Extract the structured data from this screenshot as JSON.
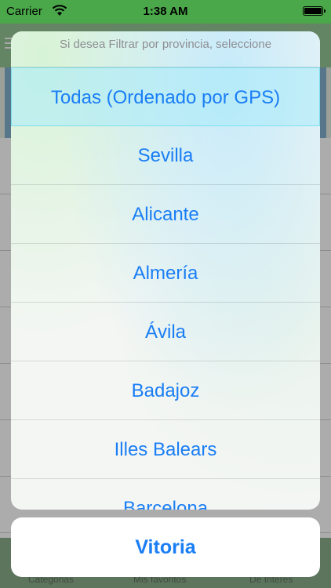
{
  "status_bar": {
    "carrier": "Carrier",
    "time": "1:38 AM"
  },
  "background": {
    "tabs": [
      {
        "label": "Categorias"
      },
      {
        "label": "Mis favoritos"
      },
      {
        "label": "De Interes"
      }
    ]
  },
  "action_sheet": {
    "title": "Si desea Filtrar por provincia, seleccione",
    "options": [
      {
        "label": "Todas (Ordenado por GPS)",
        "selected": true
      },
      {
        "label": "Sevilla"
      },
      {
        "label": "Alicante"
      },
      {
        "label": "Almería"
      },
      {
        "label": "Ávila"
      },
      {
        "label": "Badajoz"
      },
      {
        "label": "Illes Balears"
      },
      {
        "label": "Barcelona"
      }
    ],
    "cancel_label": "Vitoria"
  },
  "colors": {
    "accent": "#1a7ef5",
    "statusbar": "#4aa84a"
  }
}
